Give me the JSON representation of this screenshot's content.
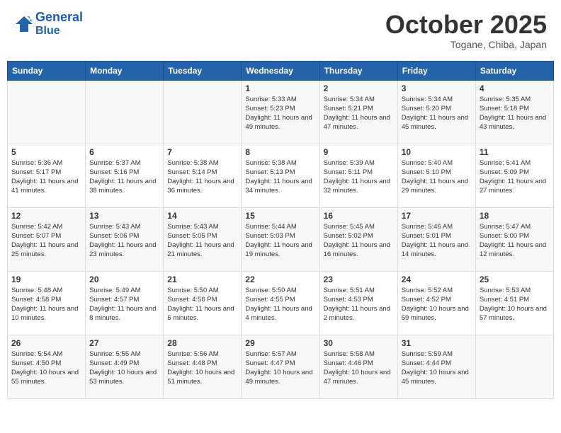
{
  "header": {
    "logo_line1": "General",
    "logo_line2": "Blue",
    "month": "October 2025",
    "location": "Togane, Chiba, Japan"
  },
  "weekdays": [
    "Sunday",
    "Monday",
    "Tuesday",
    "Wednesday",
    "Thursday",
    "Friday",
    "Saturday"
  ],
  "weeks": [
    [
      {
        "day": "",
        "info": ""
      },
      {
        "day": "",
        "info": ""
      },
      {
        "day": "",
        "info": ""
      },
      {
        "day": "1",
        "info": "Sunrise: 5:33 AM\nSunset: 5:23 PM\nDaylight: 11 hours and 49 minutes."
      },
      {
        "day": "2",
        "info": "Sunrise: 5:34 AM\nSunset: 5:21 PM\nDaylight: 11 hours and 47 minutes."
      },
      {
        "day": "3",
        "info": "Sunrise: 5:34 AM\nSunset: 5:20 PM\nDaylight: 11 hours and 45 minutes."
      },
      {
        "day": "4",
        "info": "Sunrise: 5:35 AM\nSunset: 5:18 PM\nDaylight: 11 hours and 43 minutes."
      }
    ],
    [
      {
        "day": "5",
        "info": "Sunrise: 5:36 AM\nSunset: 5:17 PM\nDaylight: 11 hours and 41 minutes."
      },
      {
        "day": "6",
        "info": "Sunrise: 5:37 AM\nSunset: 5:16 PM\nDaylight: 11 hours and 38 minutes."
      },
      {
        "day": "7",
        "info": "Sunrise: 5:38 AM\nSunset: 5:14 PM\nDaylight: 11 hours and 36 minutes."
      },
      {
        "day": "8",
        "info": "Sunrise: 5:38 AM\nSunset: 5:13 PM\nDaylight: 11 hours and 34 minutes."
      },
      {
        "day": "9",
        "info": "Sunrise: 5:39 AM\nSunset: 5:11 PM\nDaylight: 11 hours and 32 minutes."
      },
      {
        "day": "10",
        "info": "Sunrise: 5:40 AM\nSunset: 5:10 PM\nDaylight: 11 hours and 29 minutes."
      },
      {
        "day": "11",
        "info": "Sunrise: 5:41 AM\nSunset: 5:09 PM\nDaylight: 11 hours and 27 minutes."
      }
    ],
    [
      {
        "day": "12",
        "info": "Sunrise: 5:42 AM\nSunset: 5:07 PM\nDaylight: 11 hours and 25 minutes."
      },
      {
        "day": "13",
        "info": "Sunrise: 5:43 AM\nSunset: 5:06 PM\nDaylight: 11 hours and 23 minutes."
      },
      {
        "day": "14",
        "info": "Sunrise: 5:43 AM\nSunset: 5:05 PM\nDaylight: 11 hours and 21 minutes."
      },
      {
        "day": "15",
        "info": "Sunrise: 5:44 AM\nSunset: 5:03 PM\nDaylight: 11 hours and 19 minutes."
      },
      {
        "day": "16",
        "info": "Sunrise: 5:45 AM\nSunset: 5:02 PM\nDaylight: 11 hours and 16 minutes."
      },
      {
        "day": "17",
        "info": "Sunrise: 5:46 AM\nSunset: 5:01 PM\nDaylight: 11 hours and 14 minutes."
      },
      {
        "day": "18",
        "info": "Sunrise: 5:47 AM\nSunset: 5:00 PM\nDaylight: 11 hours and 12 minutes."
      }
    ],
    [
      {
        "day": "19",
        "info": "Sunrise: 5:48 AM\nSunset: 4:58 PM\nDaylight: 11 hours and 10 minutes."
      },
      {
        "day": "20",
        "info": "Sunrise: 5:49 AM\nSunset: 4:57 PM\nDaylight: 11 hours and 8 minutes."
      },
      {
        "day": "21",
        "info": "Sunrise: 5:50 AM\nSunset: 4:56 PM\nDaylight: 11 hours and 6 minutes."
      },
      {
        "day": "22",
        "info": "Sunrise: 5:50 AM\nSunset: 4:55 PM\nDaylight: 11 hours and 4 minutes."
      },
      {
        "day": "23",
        "info": "Sunrise: 5:51 AM\nSunset: 4:53 PM\nDaylight: 11 hours and 2 minutes."
      },
      {
        "day": "24",
        "info": "Sunrise: 5:52 AM\nSunset: 4:52 PM\nDaylight: 10 hours and 59 minutes."
      },
      {
        "day": "25",
        "info": "Sunrise: 5:53 AM\nSunset: 4:51 PM\nDaylight: 10 hours and 57 minutes."
      }
    ],
    [
      {
        "day": "26",
        "info": "Sunrise: 5:54 AM\nSunset: 4:50 PM\nDaylight: 10 hours and 55 minutes."
      },
      {
        "day": "27",
        "info": "Sunrise: 5:55 AM\nSunset: 4:49 PM\nDaylight: 10 hours and 53 minutes."
      },
      {
        "day": "28",
        "info": "Sunrise: 5:56 AM\nSunset: 4:48 PM\nDaylight: 10 hours and 51 minutes."
      },
      {
        "day": "29",
        "info": "Sunrise: 5:57 AM\nSunset: 4:47 PM\nDaylight: 10 hours and 49 minutes."
      },
      {
        "day": "30",
        "info": "Sunrise: 5:58 AM\nSunset: 4:46 PM\nDaylight: 10 hours and 47 minutes."
      },
      {
        "day": "31",
        "info": "Sunrise: 5:59 AM\nSunset: 4:44 PM\nDaylight: 10 hours and 45 minutes."
      },
      {
        "day": "",
        "info": ""
      }
    ]
  ]
}
